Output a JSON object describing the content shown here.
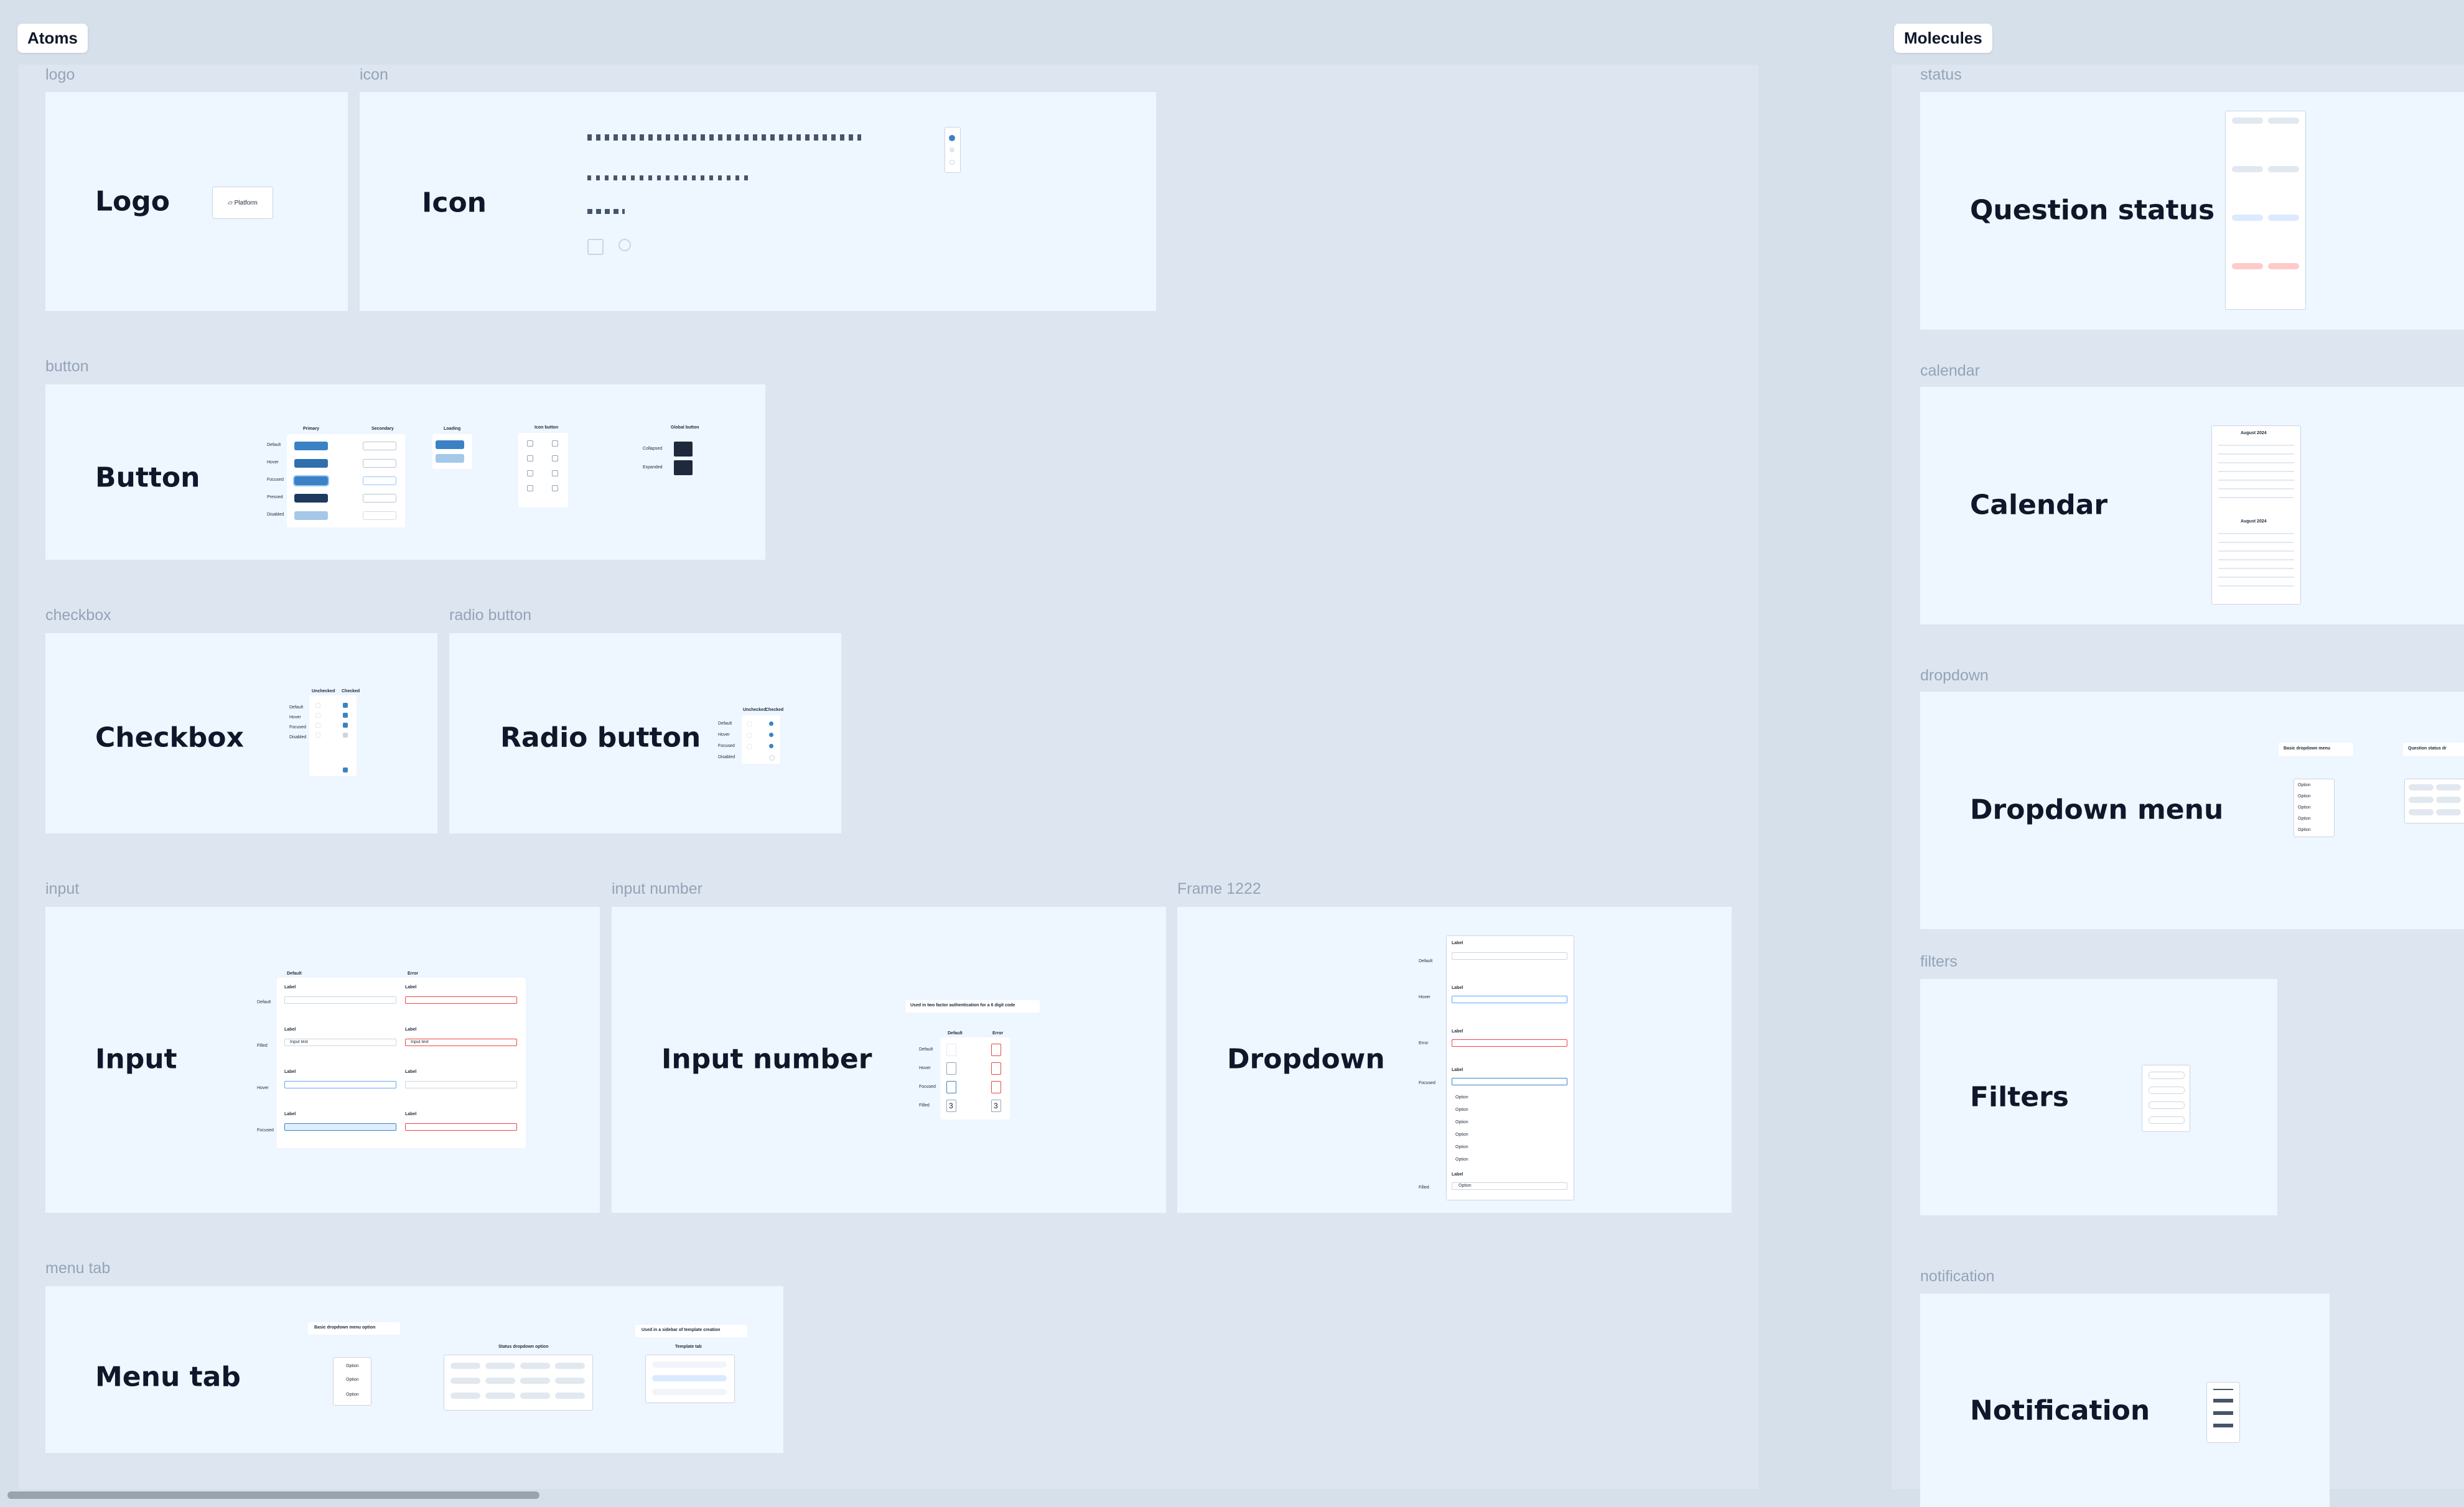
{
  "sections": {
    "atoms": "Atoms",
    "molecules": "Molecules"
  },
  "frames": {
    "logo": {
      "label": "logo",
      "title": "Logo",
      "sample": "Platform"
    },
    "icon": {
      "label": "icon",
      "title": "Icon"
    },
    "button": {
      "label": "button",
      "title": "Button",
      "cols": [
        "Primary",
        "Secondary"
      ],
      "loading": "Loading",
      "icon_button": "Icon button",
      "global_button": "Global button",
      "states": [
        "Default",
        "Hover",
        "Focused",
        "Pressed",
        "Disabled"
      ],
      "btn_text": "Button",
      "global_states": [
        "Collapsed",
        "Expanded"
      ]
    },
    "checkbox": {
      "label": "checkbox",
      "title": "Checkbox",
      "cols": [
        "Unchecked",
        "Checked"
      ],
      "states": [
        "Default",
        "Hover",
        "Focused",
        "Disabled"
      ]
    },
    "radio": {
      "label": "radio button",
      "title": "Radio button",
      "cols": [
        "Unchecked",
        "Checked"
      ],
      "states": [
        "Default",
        "Hover",
        "Focused",
        "Disabled"
      ]
    },
    "input": {
      "label": "input",
      "title": "Input",
      "cols": [
        "Default",
        "Error"
      ],
      "states": [
        "Default",
        "Filled",
        "Hover",
        "Focused"
      ],
      "field_label": "Label",
      "placeholder": "Input text"
    },
    "input_number": {
      "label": "input number",
      "title": "Input number",
      "note": "Used in two factor authentication for a 6 digit code",
      "cols": [
        "Default",
        "Error"
      ],
      "states": [
        "Default",
        "Hover",
        "Focused",
        "Filled"
      ],
      "filled_value": "3"
    },
    "frame1222": {
      "label": "Frame 1222",
      "title": "Dropdown",
      "states": [
        "Default",
        "Hover",
        "Error",
        "Focused",
        "Filled"
      ],
      "field_label": "Label",
      "option": "Option"
    },
    "menu_tab": {
      "label": "menu tab",
      "title": "Menu tab",
      "note1": "Basic dropdown menu option",
      "note2": "Used in a sidebar of template creation",
      "sub1": "Status dropdown option",
      "sub2": "Template tab",
      "option": "Option"
    },
    "status": {
      "label": "status",
      "title": "Question status"
    },
    "calendar": {
      "label": "calendar",
      "title": "Calendar",
      "month": "August 2024"
    },
    "dropdown": {
      "label": "dropdown",
      "title": "Dropdown menu",
      "note1": "Basic dropdown menu",
      "note2": "Question status dr",
      "option": "Option"
    },
    "filters": {
      "label": "filters",
      "title": "Filters"
    },
    "notification": {
      "label": "notification",
      "title": "Notification"
    }
  },
  "colors": {
    "canvas": "#d6e0eb",
    "frame_bg": "#eef6ff",
    "primary": "#3b82c4",
    "error": "#ef4444",
    "label": "#94a3b8"
  },
  "icons": [
    "search-icon",
    "gear-icon",
    "scroll-icon"
  ]
}
